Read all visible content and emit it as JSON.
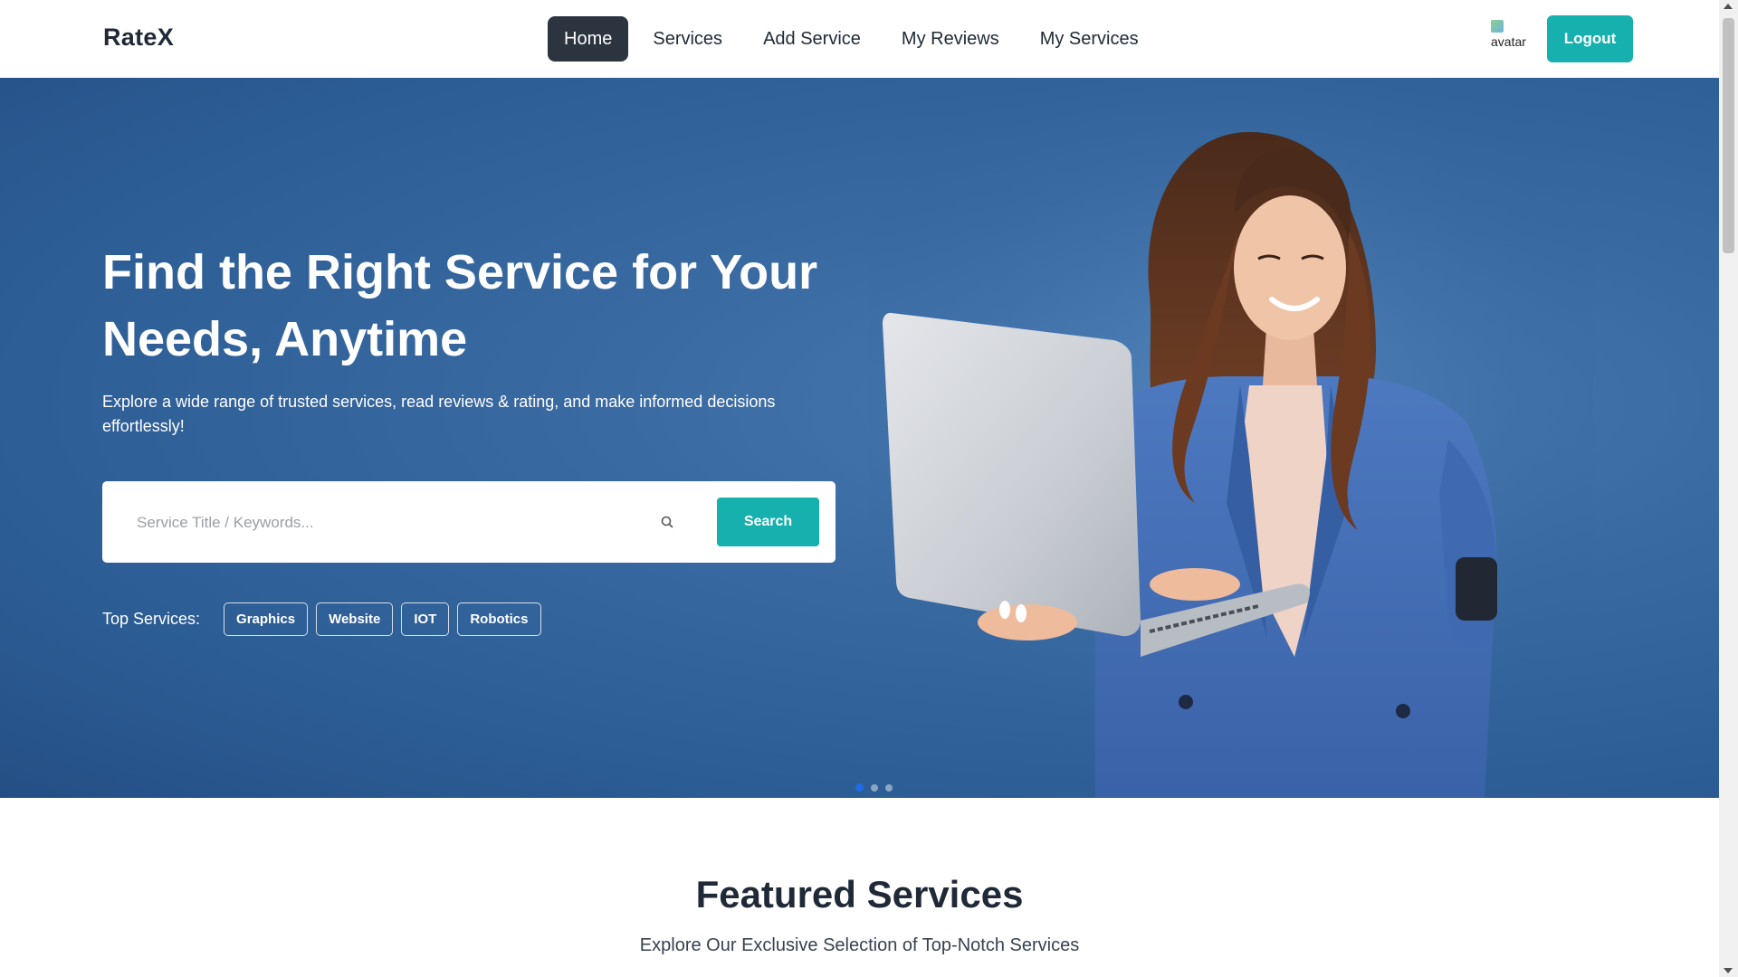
{
  "navbar": {
    "brand": "RateX",
    "items": [
      {
        "label": "Home",
        "active": true
      },
      {
        "label": "Services",
        "active": false
      },
      {
        "label": "Add Service",
        "active": false
      },
      {
        "label": "My Reviews",
        "active": false
      },
      {
        "label": "My Services",
        "active": false
      }
    ],
    "avatar_alt": "avatar",
    "logout_label": "Logout"
  },
  "hero": {
    "title": "Find the Right Service for Your Needs, Anytime",
    "subtitle": "Explore a wide range of trusted services, read reviews & rating, and make informed decisions effortlessly!",
    "search": {
      "placeholder": "Service Title / Keywords...",
      "value": "",
      "button_label": "Search",
      "icon": "search-icon"
    },
    "top_services_label": "Top Services:",
    "top_services": [
      "Graphics",
      "Website",
      "IOT",
      "Robotics"
    ],
    "carousel": {
      "slides": 3,
      "active_index": 0
    }
  },
  "featured": {
    "title": "Featured Services",
    "subtitle": "Explore Our Exclusive Selection of Top-Notch Services"
  },
  "colors": {
    "accent": "#16b1ae",
    "nav_active_bg": "#2c3440",
    "hero_bg": "#2c5c94",
    "carousel_active_dot": "#1f6ae6"
  }
}
